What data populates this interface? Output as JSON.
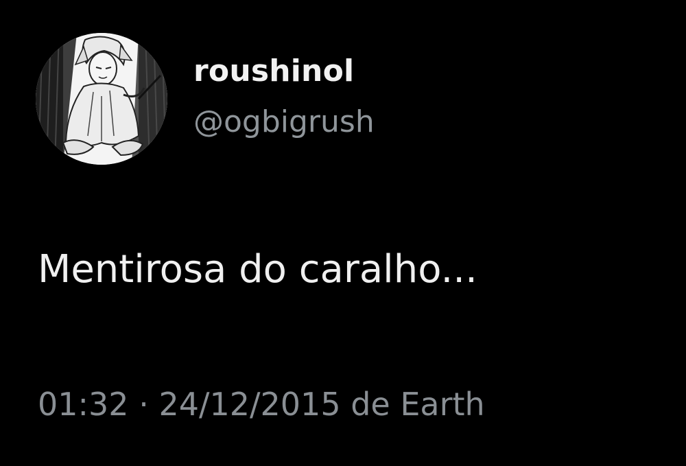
{
  "tweet": {
    "avatar_icon": "manga-character-avatar-icon",
    "display_name": "roushinol",
    "handle": "@ogbigrush",
    "text": "Mentirosa do caralho...",
    "time": "01:32",
    "separator": " · ",
    "date": "24/12/2015",
    "source": " de Earth"
  },
  "colors": {
    "background": "#000000",
    "primary_text": "#f0f0f0",
    "secondary_text": "#8a8f94"
  }
}
